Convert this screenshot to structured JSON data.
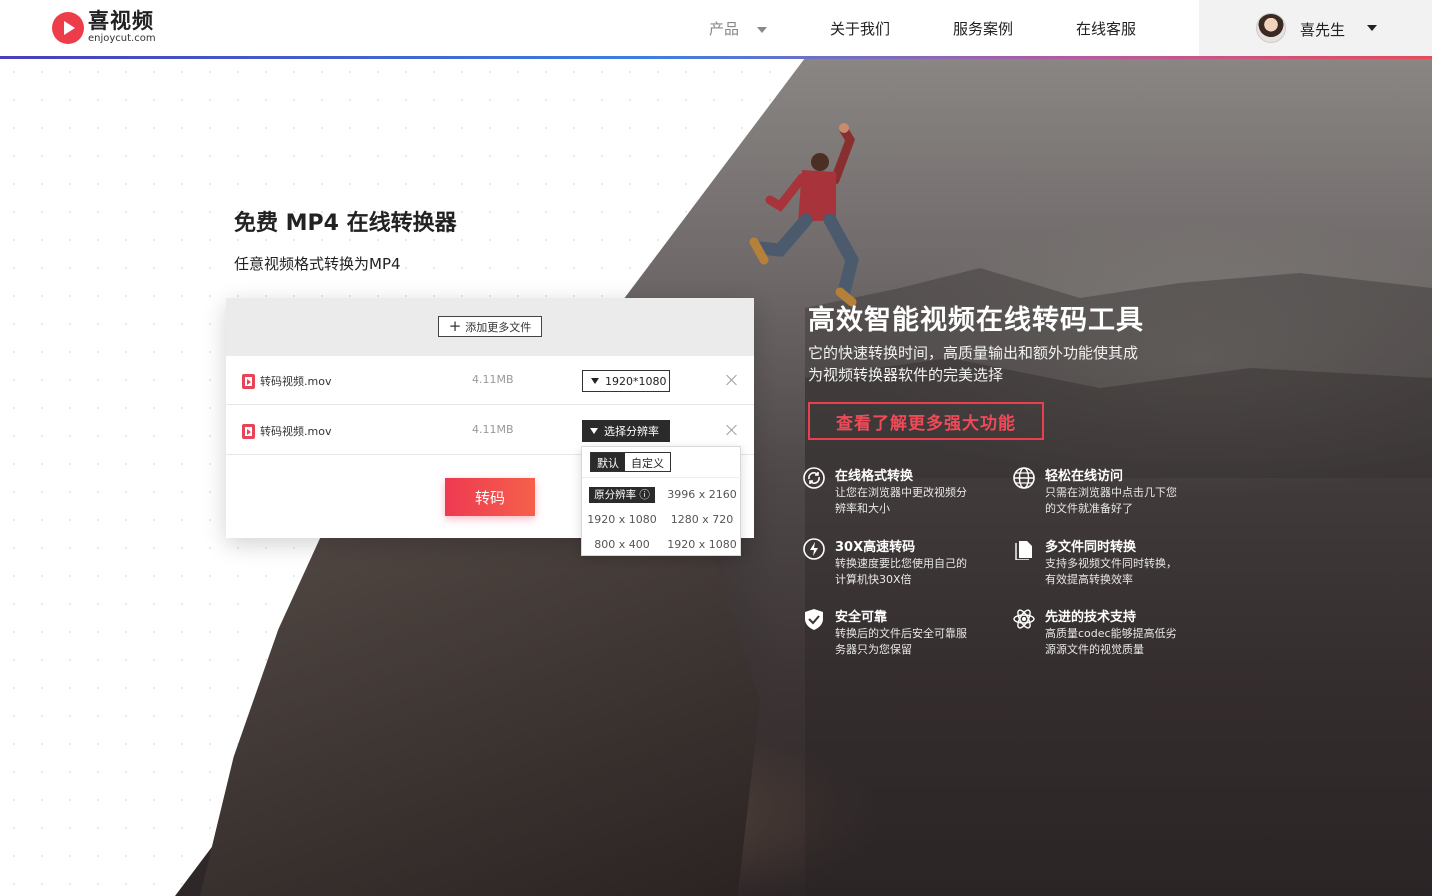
{
  "header": {
    "logo_cn": "喜视频",
    "logo_en": "enjoycut.com",
    "nav": {
      "product": "产品",
      "about": "关于我们",
      "cases": "服务案例",
      "support": "在线客服"
    },
    "user_name": "喜先生"
  },
  "intro": {
    "title": "免费 MP4 在线转换器",
    "subtitle": "任意视频格式转换为MP4"
  },
  "converter": {
    "add_files_label": "添加更多文件",
    "files": [
      {
        "name": "转码视频.mov",
        "size": "4.11MB",
        "resolution": "1920*1080"
      },
      {
        "name": "转码视频.mov",
        "size": "4.11MB",
        "resolution": "选择分辨率"
      }
    ],
    "convert_label": "转码",
    "dropdown": {
      "tabs": [
        "默认",
        "自定义"
      ],
      "original_label": "原分辨率 ⓘ",
      "options": [
        "3996 x 2160",
        "1920 x 1080",
        "1280 x 720",
        "800 x 400",
        "1920 x 1080"
      ]
    }
  },
  "hero": {
    "title": "高效智能视频在线转码工具",
    "desc": "它的快速转换时间，高质量输出和额外功能使其成为视频转换器软件的完美选择",
    "cta": "查看了解更多强大功能",
    "features": [
      {
        "title": "在线格式转换",
        "desc": "让您在浏览器中更改视频分辨率和大小",
        "icon": "refresh-icon"
      },
      {
        "title": "轻松在线访问",
        "desc": "只需在浏览器中点击几下您的文件就准备好了",
        "icon": "globe-icon"
      },
      {
        "title": "30X高速转码",
        "desc": "转换速度要比您使用自己的计算机快30X倍",
        "icon": "lightning-icon"
      },
      {
        "title": "多文件同时转换",
        "desc": "支持多视频文件同时转换，有效提高转换效率",
        "icon": "document-icon"
      },
      {
        "title": "安全可靠",
        "desc": "转换后的文件后安全可靠服务器只为您保留",
        "icon": "shield-icon"
      },
      {
        "title": "先进的技术支持",
        "desc": "高质量codec能够提高低劣源源文件的视觉质量",
        "icon": "atom-icon"
      }
    ]
  },
  "colors": {
    "accent": "#ee3a52",
    "dark": "#2b2b2b"
  }
}
